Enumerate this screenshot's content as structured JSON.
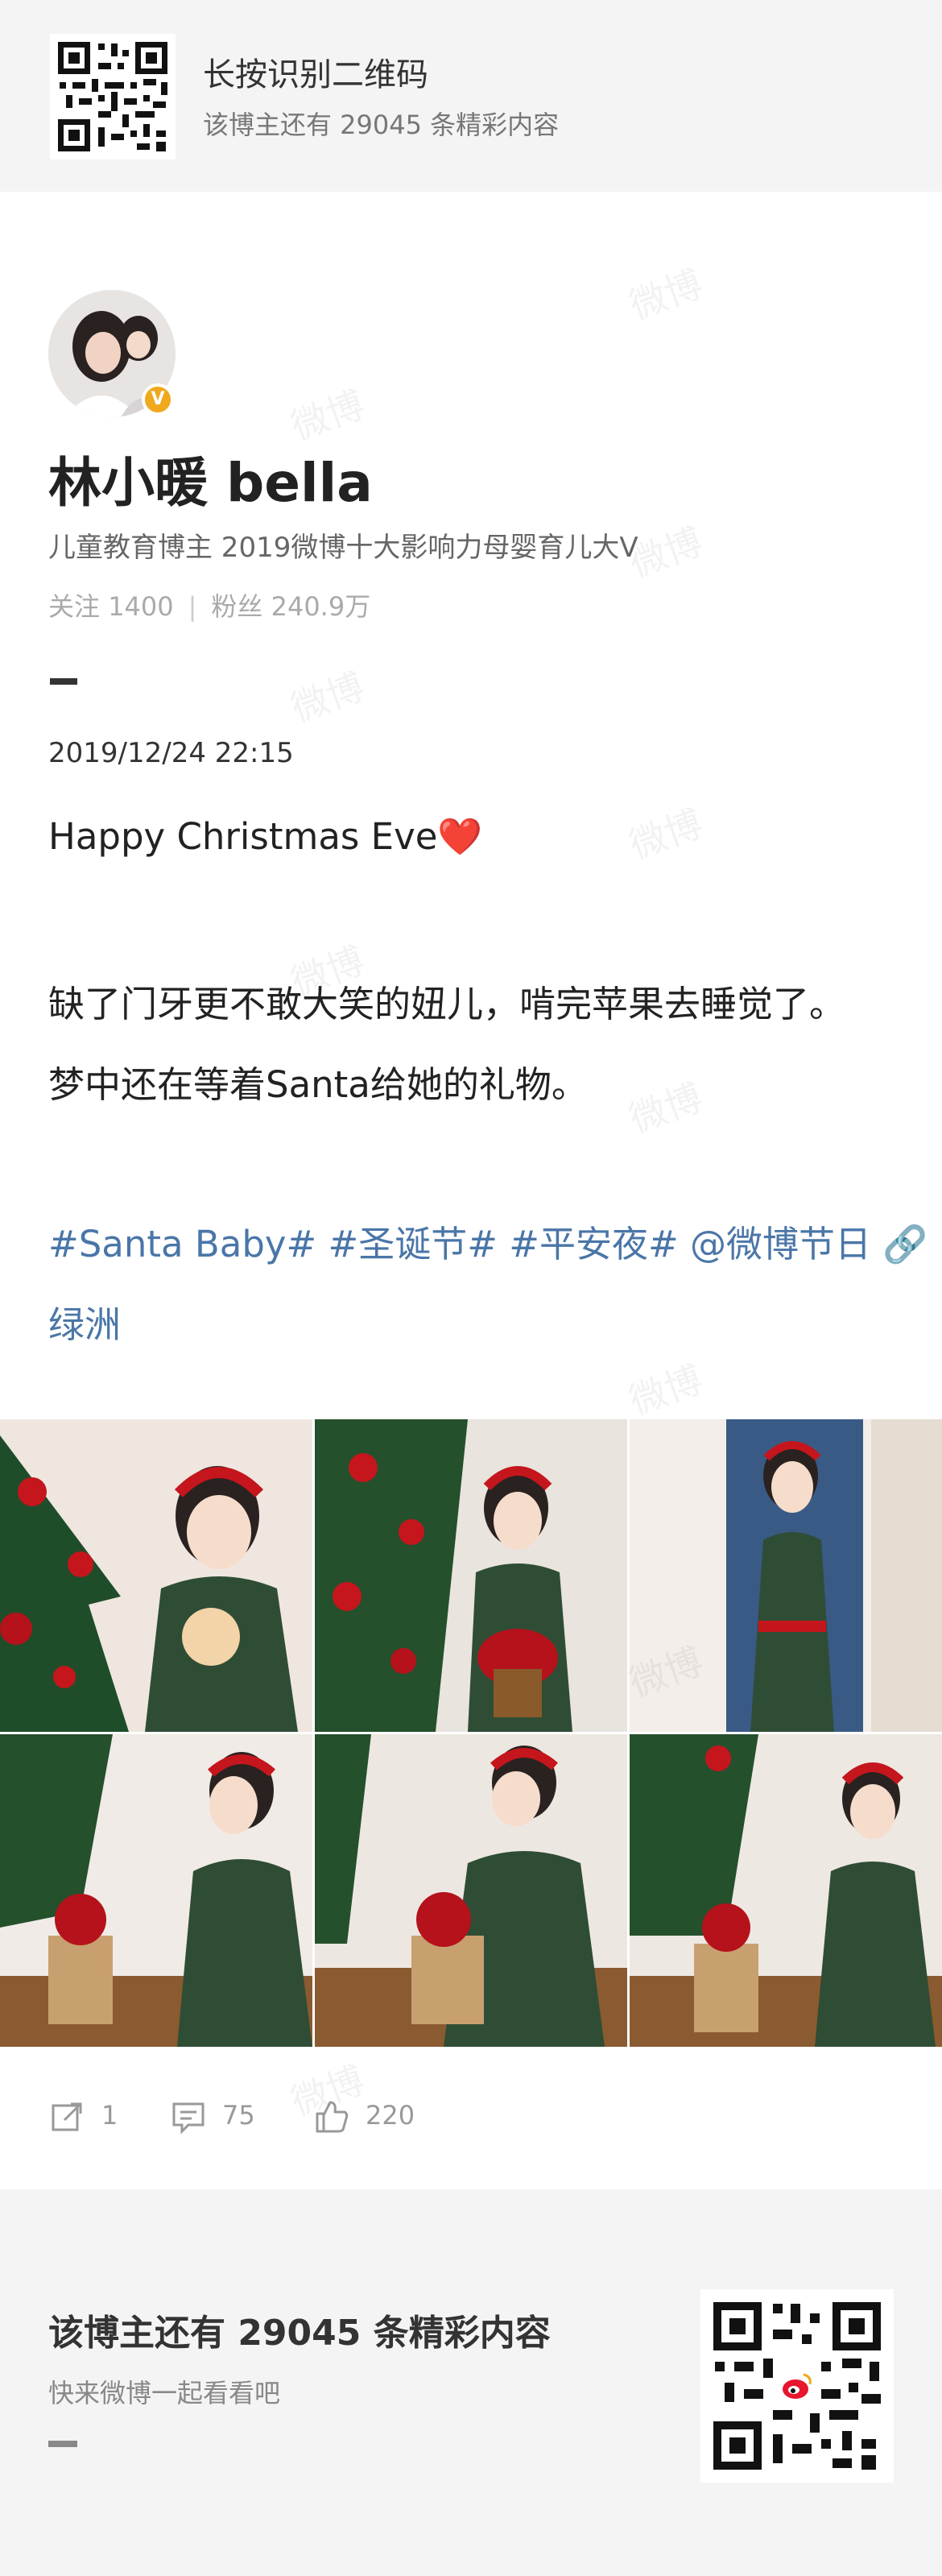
{
  "banner": {
    "title": "长按识别二维码",
    "subtitle": "该博主还有 29045 条精彩内容"
  },
  "profile": {
    "username": "林小暖 bella",
    "badge": "V",
    "bio": "儿童教育博主 2019微博十大影响力母婴育儿大V",
    "following_label": "关注",
    "following_count": "1400",
    "followers_label": "粉丝",
    "followers_count": "240.9万",
    "separator": "|"
  },
  "post": {
    "timestamp": "2019/12/24 22:15",
    "line1": "Happy Christmas Eve❤️",
    "line2": "缺了门牙更不敢大笑的妞儿，啃完苹果去睡觉了。",
    "line3": "梦中还在等着Santa给她的礼物。",
    "topics_line1": "#Santa Baby# #圣诞节# #平安夜# @微博节日 🔗",
    "topics_line2": "绿洲"
  },
  "actions": {
    "repost_count": "1",
    "comment_count": "75",
    "like_count": "220"
  },
  "footer": {
    "title": "该博主还有 29045 条精彩内容",
    "subtitle": "快来微博一起看看吧"
  },
  "watermark_text": "微博",
  "colors": {
    "link": "#4a76a8",
    "badge": "#f0a81c",
    "banner_bg": "#f4f4f4"
  }
}
